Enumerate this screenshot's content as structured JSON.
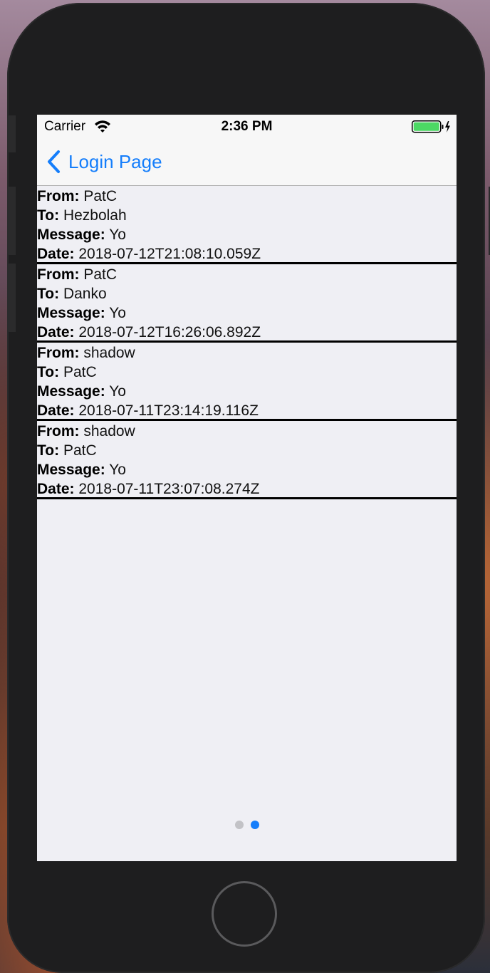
{
  "status_bar": {
    "carrier": "Carrier",
    "time": "2:36 PM",
    "wifi_icon": "wifi-icon",
    "battery_icon": "battery-charging-icon",
    "battery_color": "#4cd964"
  },
  "nav": {
    "back_label": "Login Page",
    "back_icon": "chevron-left-icon",
    "accent_color": "#157efb"
  },
  "labels": {
    "from": "From:",
    "to": "To:",
    "message": "Message:",
    "date": "Date:"
  },
  "messages": [
    {
      "from": "PatC",
      "to": "Hezbolah",
      "message": "Yo",
      "date": "2018-07-12T21:08:10.059Z"
    },
    {
      "from": "PatC",
      "to": "Danko",
      "message": "Yo",
      "date": "2018-07-12T16:26:06.892Z"
    },
    {
      "from": "shadow",
      "to": "PatC",
      "message": "Yo",
      "date": "2018-07-11T23:14:19.116Z"
    },
    {
      "from": "shadow",
      "to": "PatC",
      "message": "Yo",
      "date": "2018-07-11T23:07:08.274Z"
    }
  ],
  "page_control": {
    "total_pages": 2,
    "current_page": 2
  }
}
